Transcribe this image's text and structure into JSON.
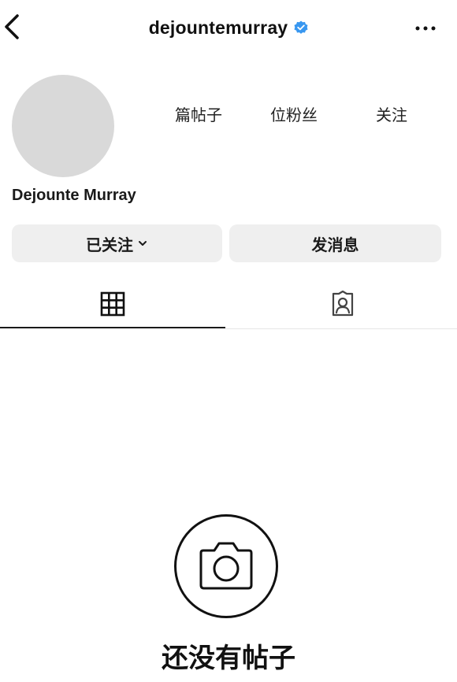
{
  "header": {
    "username": "dejountemurray",
    "back_icon": "chevron-left-icon",
    "verified_icon": "verified-badge-icon",
    "more_icon": "more-horizontal-icon"
  },
  "profile": {
    "display_name": "Dejounte Murray",
    "stats": {
      "posts_label": "篇帖子",
      "followers_label": "位粉丝",
      "following_label": "关注"
    }
  },
  "actions": {
    "following_label": "已关注",
    "message_label": "发消息"
  },
  "tabs": [
    {
      "name": "grid",
      "icon": "grid-icon",
      "active": true
    },
    {
      "name": "tagged",
      "icon": "tagged-photos-icon",
      "active": false
    }
  ],
  "empty_state": {
    "icon": "camera-icon",
    "text": "还没有帖子"
  },
  "colors": {
    "verified": "#3897f0",
    "button_bg": "#efefef",
    "avatar": "#d9d9d9"
  }
}
